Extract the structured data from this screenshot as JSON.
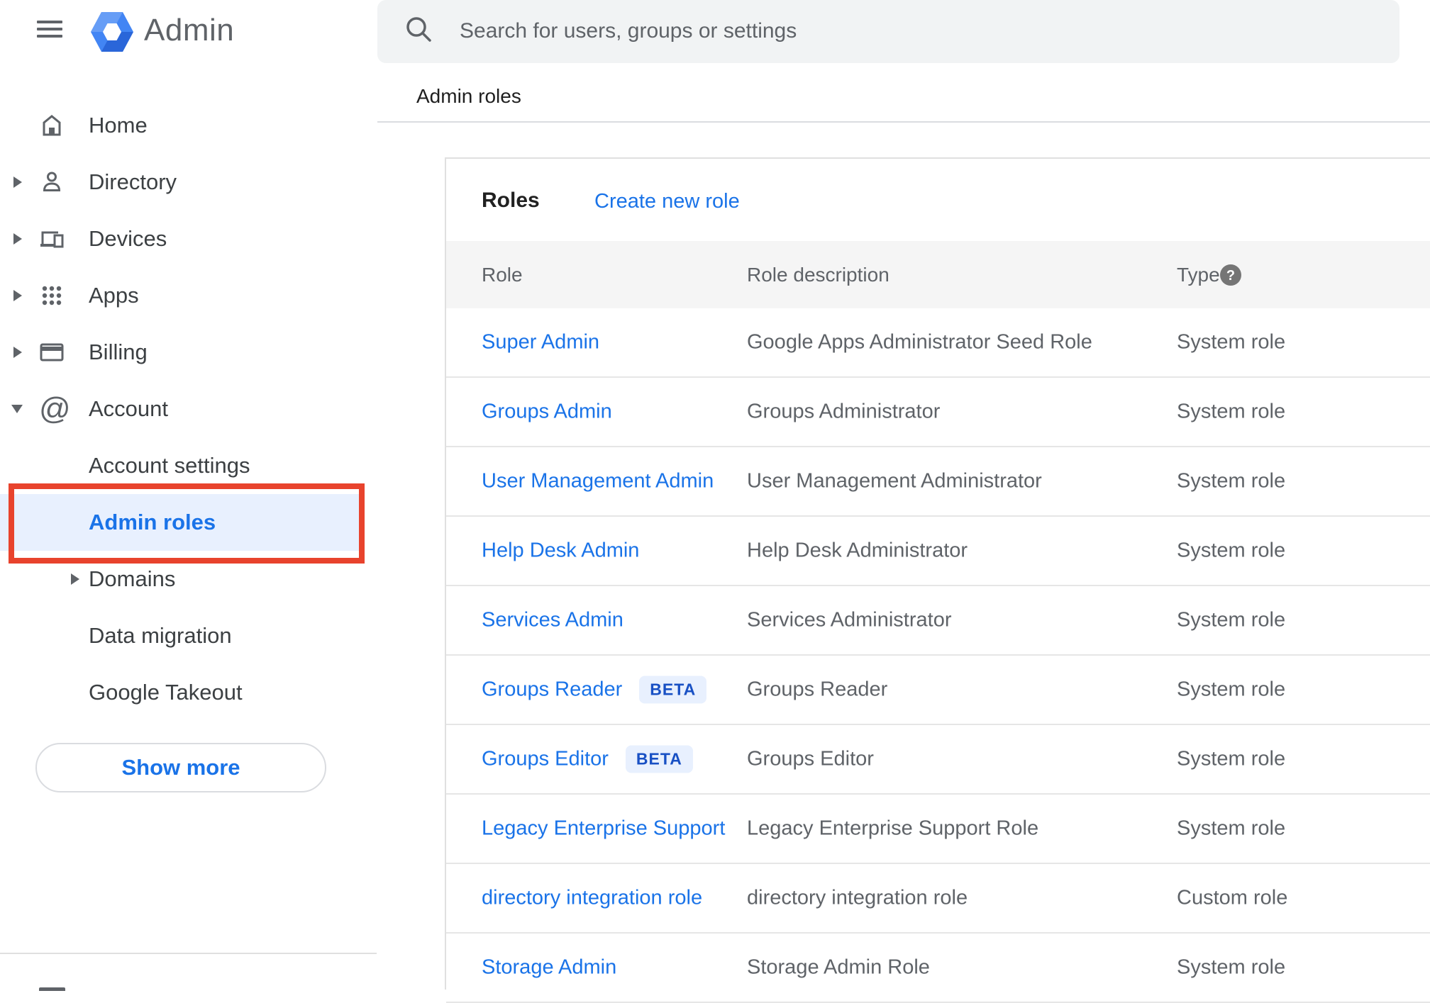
{
  "brand": {
    "product_name": "Admin"
  },
  "search": {
    "placeholder": "Search for users, groups or settings"
  },
  "breadcrumb": "Admin roles",
  "sidebar": {
    "items": [
      {
        "label": "Home"
      },
      {
        "label": "Directory"
      },
      {
        "label": "Devices"
      },
      {
        "label": "Apps"
      },
      {
        "label": "Billing"
      },
      {
        "label": "Account"
      }
    ],
    "account_children": [
      {
        "label": "Account settings"
      },
      {
        "label": "Admin roles",
        "active": true
      },
      {
        "label": "Domains"
      },
      {
        "label": "Data migration"
      },
      {
        "label": "Google Takeout"
      }
    ],
    "show_more_label": "Show more"
  },
  "roles_panel": {
    "title": "Roles",
    "create_link": "Create new role",
    "columns": [
      "Role",
      "Role description",
      "Type"
    ],
    "beta_badge_label": "BETA",
    "rows": [
      {
        "role": "Super Admin",
        "beta": false,
        "description": "Google Apps Administrator Seed Role",
        "type": "System role"
      },
      {
        "role": "Groups Admin",
        "beta": false,
        "description": "Groups Administrator",
        "type": "System role"
      },
      {
        "role": "User Management Admin",
        "beta": false,
        "description": "User Management Administrator",
        "type": "System role"
      },
      {
        "role": "Help Desk Admin",
        "beta": false,
        "description": "Help Desk Administrator",
        "type": "System role"
      },
      {
        "role": "Services Admin",
        "beta": false,
        "description": "Services Administrator",
        "type": "System role"
      },
      {
        "role": "Groups Reader",
        "beta": true,
        "description": "Groups Reader",
        "type": "System role"
      },
      {
        "role": "Groups Editor",
        "beta": true,
        "description": "Groups Editor",
        "type": "System role"
      },
      {
        "role": "Legacy Enterprise Support",
        "beta": false,
        "description": "Legacy Enterprise Support Role",
        "type": "System role"
      },
      {
        "role": "directory integration role",
        "beta": false,
        "description": "directory integration role",
        "type": "Custom role"
      },
      {
        "role": "Storage Admin",
        "beta": false,
        "description": "Storage Admin Role",
        "type": "System role"
      }
    ]
  },
  "colors": {
    "accent_blue": "#1a73e8",
    "active_item_bg": "#e8f0fe",
    "annotation_red": "#e8432d",
    "search_bar_bg": "#f1f3f4",
    "table_header_bg": "#f5f5f5",
    "icon_gray": "#5f6368",
    "divider_gray": "#e0e0e0",
    "beta_badge_bg": "#e8f0fe",
    "beta_badge_text": "#1850c4"
  }
}
